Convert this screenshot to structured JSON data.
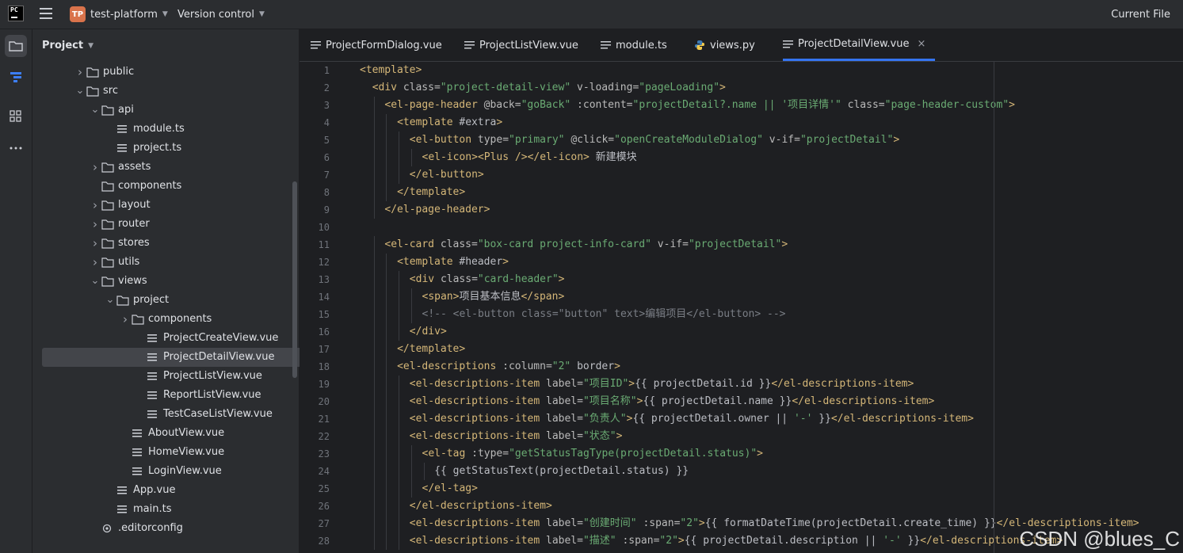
{
  "topbar": {
    "project_badge": "TP",
    "project_name": "test-platform",
    "vcs_label": "Version control",
    "run_config": "Current File"
  },
  "panel": {
    "title": "Project"
  },
  "tree": [
    {
      "label": "public",
      "type": "folder",
      "depth": 1,
      "expanded": false
    },
    {
      "label": "src",
      "type": "folder",
      "depth": 1,
      "expanded": true
    },
    {
      "label": "api",
      "type": "folder",
      "depth": 2,
      "expanded": true
    },
    {
      "label": "module.ts",
      "type": "file",
      "depth": 3
    },
    {
      "label": "project.ts",
      "type": "file",
      "depth": 3
    },
    {
      "label": "assets",
      "type": "folder",
      "depth": 2,
      "expanded": false
    },
    {
      "label": "components",
      "type": "folder",
      "depth": 2,
      "expanded": null
    },
    {
      "label": "layout",
      "type": "folder",
      "depth": 2,
      "expanded": false
    },
    {
      "label": "router",
      "type": "folder",
      "depth": 2,
      "expanded": false
    },
    {
      "label": "stores",
      "type": "folder",
      "depth": 2,
      "expanded": false
    },
    {
      "label": "utils",
      "type": "folder",
      "depth": 2,
      "expanded": false
    },
    {
      "label": "views",
      "type": "folder",
      "depth": 2,
      "expanded": true
    },
    {
      "label": "project",
      "type": "folder",
      "depth": 3,
      "expanded": true
    },
    {
      "label": "components",
      "type": "folder",
      "depth": 4,
      "expanded": false
    },
    {
      "label": "ProjectCreateView.vue",
      "type": "file",
      "depth": 5
    },
    {
      "label": "ProjectDetailView.vue",
      "type": "file",
      "depth": 5,
      "selected": true
    },
    {
      "label": "ProjectListView.vue",
      "type": "file",
      "depth": 5
    },
    {
      "label": "ReportListView.vue",
      "type": "file",
      "depth": 5
    },
    {
      "label": "TestCaseListView.vue",
      "type": "file",
      "depth": 5
    },
    {
      "label": "AboutView.vue",
      "type": "file",
      "depth": 4
    },
    {
      "label": "HomeView.vue",
      "type": "file",
      "depth": 4
    },
    {
      "label": "LoginView.vue",
      "type": "file",
      "depth": 4
    },
    {
      "label": "App.vue",
      "type": "file",
      "depth": 3
    },
    {
      "label": "main.ts",
      "type": "file",
      "depth": 3
    },
    {
      "label": ".editorconfig",
      "type": "config",
      "depth": 2
    }
  ],
  "tabs": [
    {
      "label": "ProjectFormDialog.vue",
      "icon": "file-lines-icon"
    },
    {
      "label": "ProjectListView.vue",
      "icon": "file-lines-icon"
    },
    {
      "label": "module.ts",
      "icon": "file-lines-icon"
    },
    {
      "label": "views.py",
      "icon": "python-icon"
    },
    {
      "label": "ProjectDetailView.vue",
      "icon": "file-lines-icon",
      "active": true,
      "close": "×"
    }
  ],
  "code": [
    {
      "n": "1",
      "indent": 0,
      "text": "<template>"
    },
    {
      "n": "2",
      "indent": 1,
      "text": "<div class=\"project-detail-view\" v-loading=\"pageLoading\">"
    },
    {
      "n": "3",
      "indent": 2,
      "text": "<el-page-header @back=\"goBack\" :content=\"projectDetail?.name || '项目详情'\" class=\"page-header-custom\">"
    },
    {
      "n": "4",
      "indent": 3,
      "text": "<template #extra>"
    },
    {
      "n": "5",
      "indent": 4,
      "text": "<el-button type=\"primary\" @click=\"openCreateModuleDialog\" v-if=\"projectDetail\">"
    },
    {
      "n": "6",
      "indent": 5,
      "text": "<el-icon><Plus /></el-icon> 新建模块"
    },
    {
      "n": "7",
      "indent": 4,
      "text": "</el-button>"
    },
    {
      "n": "8",
      "indent": 3,
      "text": "</template>"
    },
    {
      "n": "9",
      "indent": 2,
      "text": "</el-page-header>"
    },
    {
      "n": "10",
      "indent": 0,
      "text": ""
    },
    {
      "n": "11",
      "indent": 2,
      "text": "<el-card class=\"box-card project-info-card\" v-if=\"projectDetail\">"
    },
    {
      "n": "12",
      "indent": 3,
      "text": "<template #header>"
    },
    {
      "n": "13",
      "indent": 4,
      "text": "<div class=\"card-header\">"
    },
    {
      "n": "14",
      "indent": 5,
      "text": "<span>项目基本信息</span>"
    },
    {
      "n": "15",
      "indent": 5,
      "text": "<!-- <el-button class=\"button\" text>编辑项目</el-button> -->"
    },
    {
      "n": "16",
      "indent": 4,
      "text": "</div>"
    },
    {
      "n": "17",
      "indent": 3,
      "text": "</template>"
    },
    {
      "n": "18",
      "indent": 3,
      "text": "<el-descriptions :column=\"2\" border>"
    },
    {
      "n": "19",
      "indent": 4,
      "text": "<el-descriptions-item label=\"项目ID\">{{ projectDetail.id }}</el-descriptions-item>"
    },
    {
      "n": "20",
      "indent": 4,
      "text": "<el-descriptions-item label=\"项目名称\">{{ projectDetail.name }}</el-descriptions-item>"
    },
    {
      "n": "21",
      "indent": 4,
      "text": "<el-descriptions-item label=\"负责人\">{{ projectDetail.owner || '-' }}</el-descriptions-item>"
    },
    {
      "n": "22",
      "indent": 4,
      "text": "<el-descriptions-item label=\"状态\">"
    },
    {
      "n": "23",
      "indent": 5,
      "text": "<el-tag :type=\"getStatusTagType(projectDetail.status)\">"
    },
    {
      "n": "24",
      "indent": 6,
      "text": "{{ getStatusText(projectDetail.status) }}"
    },
    {
      "n": "25",
      "indent": 5,
      "text": "</el-tag>"
    },
    {
      "n": "26",
      "indent": 4,
      "text": "</el-descriptions-item>"
    },
    {
      "n": "27",
      "indent": 4,
      "text": "<el-descriptions-item label=\"创建时间\" :span=\"2\">{{ formatDateTime(projectDetail.create_time) }}</el-descriptions-item>"
    },
    {
      "n": "28",
      "indent": 4,
      "text": "<el-descriptions-item label=\"描述\" :span=\"2\">{{ projectDetail.description || '-' }}</el-descriptions-item>"
    }
  ],
  "watermark": "CSDN @blues_C",
  "colors": {
    "tag": "#d5b778",
    "attr": "#bababa",
    "string": "#6aab73",
    "comment": "#7a7e85",
    "text": "#bcbec4",
    "accent": "#3574f0"
  }
}
